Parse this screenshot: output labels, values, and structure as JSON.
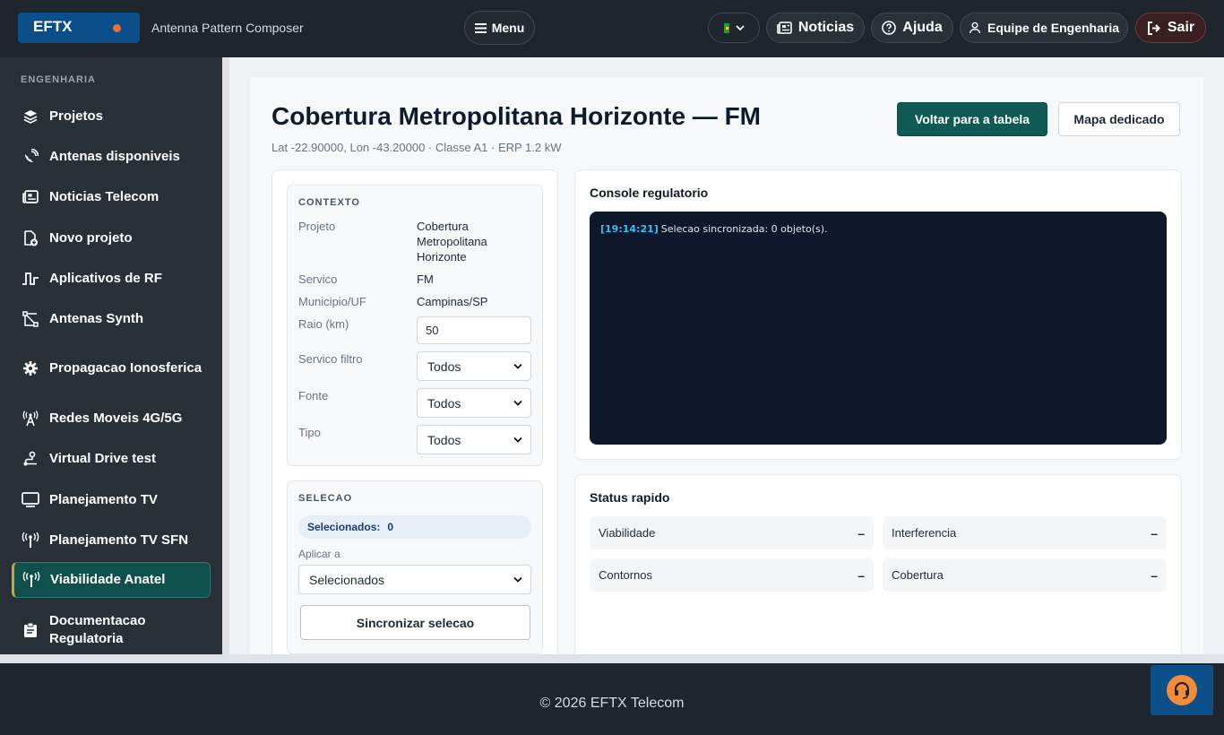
{
  "brand": {
    "logo_text": "EFTX",
    "app_title": "Antenna Pattern Composer"
  },
  "topbar": {
    "menu_label": "Menu",
    "news_label": "Noticias",
    "help_label": "Ajuda",
    "team_label": "Equipe de Engenharia",
    "logout_label": "Sair",
    "language_flag": "brazil-flag-icon"
  },
  "sidebar": {
    "section_title": "ENGENHARIA",
    "items": [
      {
        "label": "Projetos",
        "icon": "layers-icon"
      },
      {
        "label": "Antenas disponiveis",
        "icon": "satellite-dish-icon"
      },
      {
        "label": "Noticias Telecom",
        "icon": "newspaper-icon"
      },
      {
        "label": "Novo projeto",
        "icon": "file-plus-icon"
      },
      {
        "label": "Aplicativos de RF",
        "icon": "signal-wave-icon"
      },
      {
        "label": "Antenas Synth",
        "icon": "synth-antenna-icon"
      },
      {
        "label": "Propagacao Ionosferica",
        "icon": "gear-icon"
      },
      {
        "label": "Redes Moveis 4G/5G",
        "icon": "cell-tower-icon"
      },
      {
        "label": "Virtual Drive test",
        "icon": "route-icon"
      },
      {
        "label": "Planejamento TV",
        "icon": "monitor-icon"
      },
      {
        "label": "Planejamento TV SFN",
        "icon": "broadcast-tower-icon"
      },
      {
        "label": "Viabilidade Anatel",
        "icon": "broadcast-tower-icon",
        "active": true
      },
      {
        "label": "Documentacao Regulatoria",
        "icon": "clipboard-icon"
      }
    ]
  },
  "page": {
    "title": "Cobertura Metropolitana Horizonte — FM",
    "subtitle": "Lat -22.90000, Lon -43.20000 · Classe A1 · ERP 1.2 kW",
    "back_button": "Voltar para a tabela",
    "map_button": "Mapa dedicado"
  },
  "context": {
    "heading": "CONTEXTO",
    "project_label": "Projeto",
    "project_value": "Cobertura Metropolitana Horizonte",
    "service_label": "Servico",
    "service_value": "FM",
    "city_label": "Municipio/UF",
    "city_value": "Campinas/SP",
    "radius_label": "Raio (km)",
    "radius_value": "50",
    "service_filter_label": "Servico filtro",
    "service_filter_value": "Todos",
    "source_label": "Fonte",
    "source_value": "Todos",
    "type_label": "Tipo",
    "type_value": "Todos"
  },
  "selection": {
    "heading": "SELECAO",
    "selected_label": "Selecionados:",
    "selected_count": "0",
    "apply_label": "Aplicar a",
    "apply_value": "Selecionados",
    "sync_button": "Sincronizar selecao"
  },
  "console": {
    "title": "Console regulatorio",
    "lines": [
      {
        "time": "[19:14:21]",
        "message": "Selecao sincronizada: 0 objeto(s)."
      }
    ]
  },
  "status": {
    "title": "Status rapido",
    "items": [
      {
        "label": "Viabilidade",
        "value": "–"
      },
      {
        "label": "Interferencia",
        "value": "–"
      },
      {
        "label": "Contornos",
        "value": "–"
      },
      {
        "label": "Cobertura",
        "value": "–"
      }
    ]
  },
  "footer": {
    "copyright": "© 2026 EFTX Telecom"
  },
  "colors": {
    "accent": "#0f5a55",
    "brand": "#0b4f8a",
    "topbar": "#1f252d",
    "sidebar": "#2a3038",
    "console_bg": "#0f172a"
  }
}
